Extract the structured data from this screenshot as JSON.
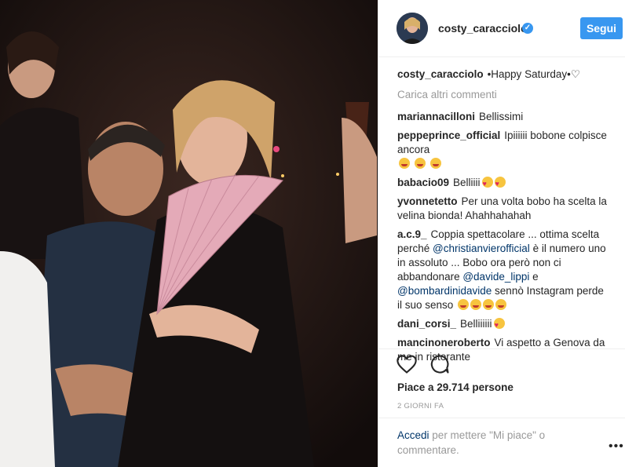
{
  "post": {
    "username": "costy_caracciolo",
    "verified_icon": "verified-badge-icon",
    "follow_label": "Segui",
    "caption_user": "costy_caracciolo",
    "caption_text": "•Happy Saturday•♡",
    "load_more": "Carica altri commenti",
    "comments": [
      {
        "user": "mariannacilloni",
        "text": "Bellissimi"
      },
      {
        "user": "peppeprince_official",
        "text": "Ipiiiiii bobone colpisce ancora"
      },
      {
        "user": "babacio09",
        "text": "Belliiii"
      },
      {
        "user": "yvonnetetto",
        "text": "Per una volta bobo ha scelta la velina bionda! Ahahhahahah"
      },
      {
        "user": "a.c.9_",
        "text_1": "Coppia spettacolare ... ottima scelta perché",
        "mention_1": "@christianvierofficial",
        "text_2": "è il numero uno in assoluto ... Bobo ora però non ci abbandonare",
        "mention_2": "@davide_lippi",
        "text_3": "e",
        "mention_3": "@bombardinidavide",
        "text_4": "sennò Instagram perde il suo senso"
      },
      {
        "user": "dani_corsi_",
        "text": "Belliiiiii"
      },
      {
        "user": "mancinoneroberto",
        "text": "Vi aspetto a Genova da me in ristorante"
      }
    ],
    "likes": "Piace a 29.714 persone",
    "time": "2 GIORNI FA",
    "footer_link": "Accedi",
    "footer_text": "per mettere \"Mi piace\" o commentare.",
    "more_label": "•••"
  },
  "colors": {
    "accent": "#3897f0",
    "mention": "#003569",
    "muted": "#999999"
  }
}
